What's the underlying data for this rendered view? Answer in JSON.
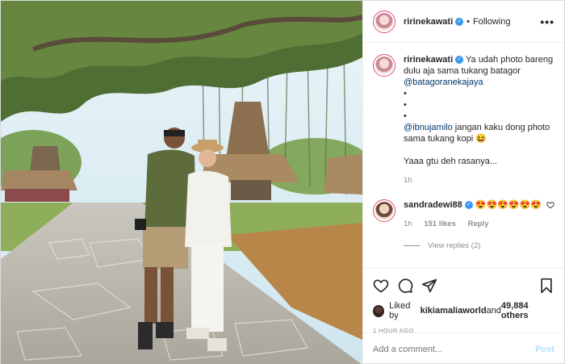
{
  "header": {
    "username": "ririnekawati",
    "follow_status": "Following",
    "more_icon": "•••"
  },
  "caption": {
    "username": "ririnekawati",
    "text_1": "Ya udah photo bareng dulu aja sama tukang batagor",
    "mention_1": "@batagoranekajaya",
    "bullets": [
      "•",
      "•",
      "•"
    ],
    "mention_2": "@ibnujamilo",
    "text_2": " jangan kaku dong photo sama tukang kopi 😆",
    "text_3": "Yaaa gtu deh rasanya...",
    "time": "1h"
  },
  "comment": {
    "username": "sandradewi88",
    "text": "😍😍😍😍😍😍",
    "time": "1h",
    "likes": "151 likes",
    "reply": "Reply",
    "view_replies": "View replies (2)"
  },
  "likes": {
    "prefix": "Liked by ",
    "user": "kikiamaliaworld",
    "and": " and ",
    "count": "49,884 others"
  },
  "timestamp": "1 HOUR AGO",
  "add_comment": {
    "placeholder": "Add a comment...",
    "post_label": "Post"
  },
  "colors": {
    "accent_blue": "#3897f0",
    "post_disabled": "#b2dffc",
    "story_ring": "#e04f79",
    "muted": "#8e8e8e"
  },
  "icons": [
    "heart-icon",
    "comment-icon",
    "share-icon",
    "bookmark-icon",
    "verified-badge-icon",
    "more-options-icon"
  ]
}
